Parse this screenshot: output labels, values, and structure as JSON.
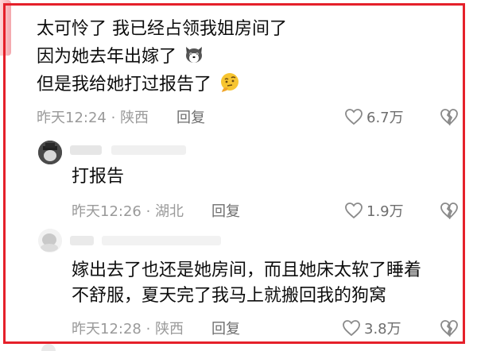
{
  "comments": [
    {
      "lines": [
        "太可怜了  我已经占领我姐房间了",
        "因为她去年出嫁了",
        "但是我给她打过报告了"
      ],
      "emojis": [
        "husky-dog-emoji",
        "thinking-face-emoji"
      ],
      "time": "昨天12:24",
      "location": "陕西",
      "reply_label": "回复",
      "likes": "6.7万"
    },
    {
      "lines": [
        "打报告"
      ],
      "time": "昨天12:26",
      "location": "湖北",
      "reply_label": "回复",
      "likes": "1.9万"
    },
    {
      "lines": [
        "嫁出去了也还是她房间，而且她床太软了睡着",
        "不舒服，夏天完了我马上就搬回我的狗窝"
      ],
      "time": "昨天12:28",
      "location": "陕西",
      "reply_label": "回复",
      "likes": "3.8万"
    }
  ],
  "icons": [
    "heart-outline-icon",
    "broken-heart-icon"
  ],
  "colors": {
    "frame": "#e5202a",
    "meta_text": "#9a9a9a",
    "body_text": "#0d0d0d"
  }
}
